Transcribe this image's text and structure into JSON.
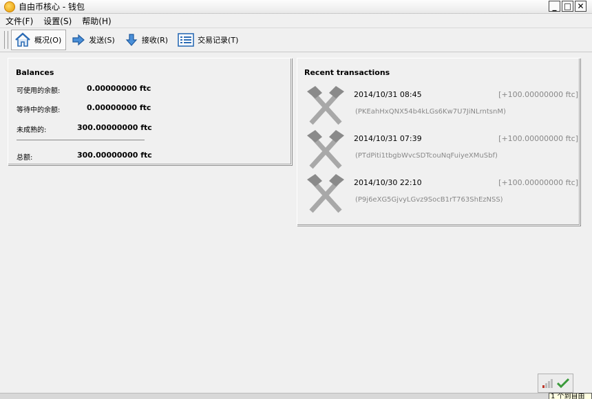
{
  "window": {
    "title": "自由币核心 - 钱包"
  },
  "menu": [
    {
      "label": "文件(F)"
    },
    {
      "label": "设置(S)"
    },
    {
      "label": "帮助(H)"
    }
  ],
  "toolbar": {
    "overview": "概况(O)",
    "send": "发送(S)",
    "receive": "接收(R)",
    "transactions": "交易记录(T)"
  },
  "balances": {
    "title": "Balances",
    "available_label": "可使用的余额:",
    "available_value": "0.00000000 ftc",
    "pending_label": "等待中的余额:",
    "pending_value": "0.00000000 ftc",
    "immature_label": "未成熟的:",
    "immature_value": "300.00000000 ftc",
    "total_label": "总额:",
    "total_value": "300.00000000 ftc"
  },
  "recent": {
    "title": "Recent transactions",
    "items": [
      {
        "date": "2014/10/31 08:45",
        "amount": "[+100.00000000 ftc]",
        "address": "(PKEahHxQNX54b4kLGs6Kw7U7JiNLrntsnM)"
      },
      {
        "date": "2014/10/31 07:39",
        "amount": "[+100.00000000 ftc]",
        "address": "(PTdPiti1tbgbWvcSDTcouNqFuiyeXMuSbf)"
      },
      {
        "date": "2014/10/30 22:10",
        "amount": "[+100.00000000 ftc]",
        "address": "(P9j6eXG5GjvyLGvz9SocB1rT763ShEzNSS)"
      }
    ]
  },
  "status": {
    "tooltip": "1 个到自由"
  },
  "colors": {
    "accent": "#2a6bb5",
    "muted": "#888888"
  },
  "icons": {
    "overview": "home-icon",
    "send": "arrow-right-icon",
    "receive": "arrow-down-icon",
    "transactions": "list-icon",
    "tx": "mined-hammer-icon",
    "network": "signal-bars-icon",
    "sync": "check-icon"
  }
}
